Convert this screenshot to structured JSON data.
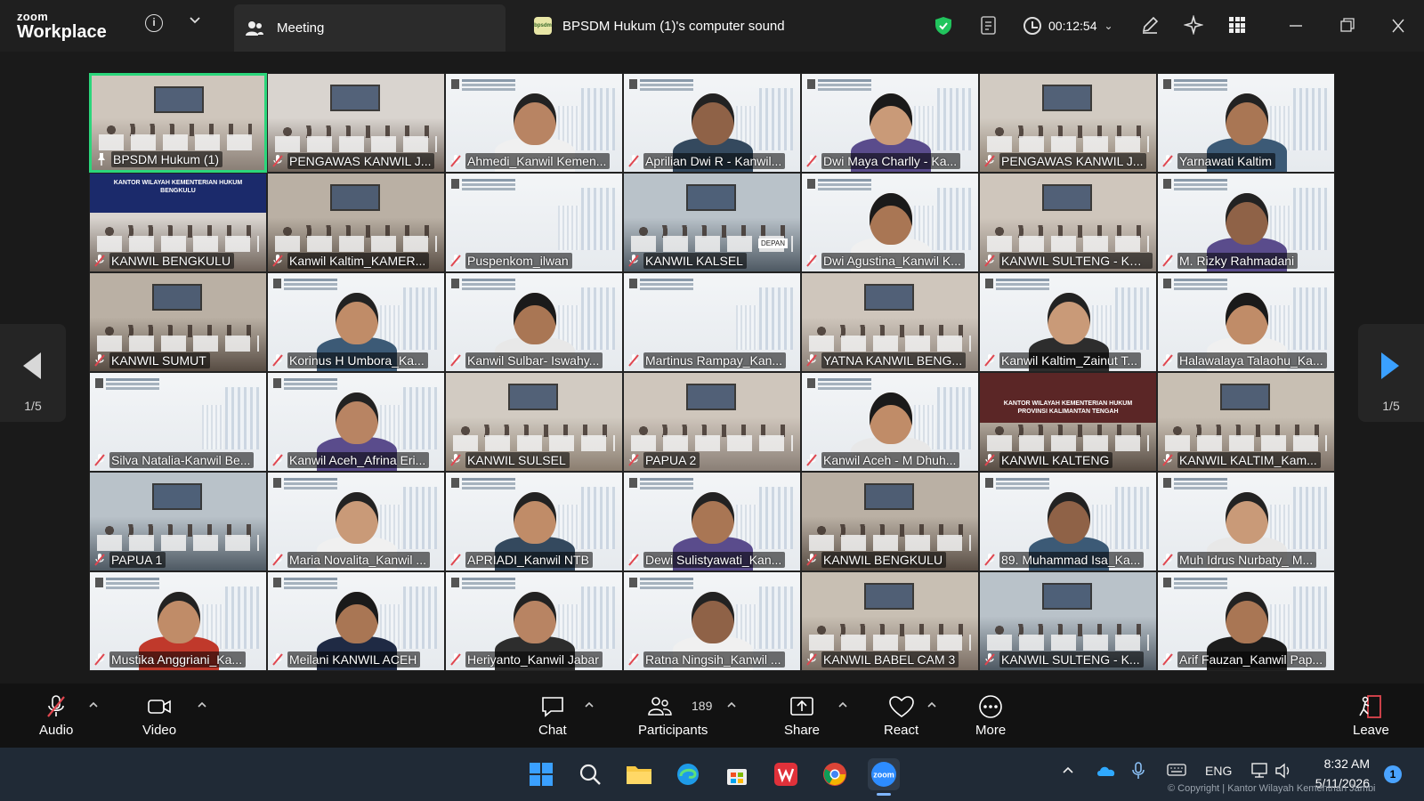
{
  "app": {
    "brand_top": "zoom",
    "brand_bottom": "Workplace"
  },
  "titlebar": {
    "meeting_tab": "Meeting",
    "sound_tab": "BPSDM Hukum (1)'s computer sound",
    "timer": "00:12:54"
  },
  "navigation": {
    "left_page": "1/5",
    "right_page": "1/5"
  },
  "participants_grid": [
    {
      "name": "BPSDM Hukum (1)",
      "type": "room",
      "active": true
    },
    {
      "name": "PENGAWAS KANWIL J...",
      "type": "room"
    },
    {
      "name": "Ahmedi_Kanwil Kemen...",
      "type": "person"
    },
    {
      "name": "Aprilian Dwi R - Kanwil...",
      "type": "person"
    },
    {
      "name": "Dwi Maya Charlly - Ka...",
      "type": "person"
    },
    {
      "name": "PENGAWAS KANWIL J...",
      "type": "room"
    },
    {
      "name": "Yarnawati Kaltim",
      "type": "person"
    },
    {
      "name": "KANWIL BENGKULU",
      "type": "room"
    },
    {
      "name": "Kanwil Kaltim_KAMER...",
      "type": "room"
    },
    {
      "name": "Puspenkom_ilwan",
      "type": "blank"
    },
    {
      "name": "KANWIL KALSEL",
      "type": "room"
    },
    {
      "name": "Dwi Agustina_Kanwil K...",
      "type": "person"
    },
    {
      "name": "KANWIL SULTENG - KAM...",
      "type": "room"
    },
    {
      "name": "M. Rizky Rahmadani",
      "type": "person"
    },
    {
      "name": "KANWIL SUMUT",
      "type": "room"
    },
    {
      "name": "Korinus H Umbora_Ka...",
      "type": "person"
    },
    {
      "name": "Kanwil Sulbar- Iswahy...",
      "type": "person"
    },
    {
      "name": "Martinus Rampay_Kan...",
      "type": "blank"
    },
    {
      "name": "YATNA KANWIL BENG...",
      "type": "room"
    },
    {
      "name": "Kanwil Kaltim_Zainut T...",
      "type": "person"
    },
    {
      "name": "Halawalaya Talaohu_Ka...",
      "type": "person"
    },
    {
      "name": "Silva Natalia-Kanwil Be...",
      "type": "blank"
    },
    {
      "name": "Kanwil  Aceh_Afrina Eri...",
      "type": "person"
    },
    {
      "name": "KANWIL SULSEL",
      "type": "room"
    },
    {
      "name": "PAPUA 2",
      "type": "room"
    },
    {
      "name": "Kanwil Aceh - M Dhuh...",
      "type": "person"
    },
    {
      "name": "KANWIL KALTENG",
      "type": "room"
    },
    {
      "name": "KANWIL KALTIM_Kam...",
      "type": "room"
    },
    {
      "name": "PAPUA 1",
      "type": "room"
    },
    {
      "name": "Maria Novalita_Kanwil ...",
      "type": "person"
    },
    {
      "name": "APRIADI_Kanwil NTB",
      "type": "person"
    },
    {
      "name": "Dewi Sulistyawati_Kan...",
      "type": "person"
    },
    {
      "name": "KANWIL BENGKULU",
      "type": "room"
    },
    {
      "name": "89. Muhammad Isa_Ka...",
      "type": "person"
    },
    {
      "name": "Muh Idrus Nurbaty_ M...",
      "type": "person"
    },
    {
      "name": "Mustika Anggriani_Ka...",
      "type": "person"
    },
    {
      "name": "Meilani KANWIL ACEH",
      "type": "person"
    },
    {
      "name": "Heriyanto_Kanwil Jabar",
      "type": "person"
    },
    {
      "name": "Ratna Ningsih_Kanwil ...",
      "type": "person"
    },
    {
      "name": "KANWIL BABEL CAM 3",
      "type": "room"
    },
    {
      "name": "KANWIL SULTENG - K...",
      "type": "room"
    },
    {
      "name": "Arif Fauzan_Kanwil Pap...",
      "type": "person"
    }
  ],
  "tile_overlays": {
    "bengkulu_banner_1": "KANTOR WILAYAH KEMENTERIAN HUKUM",
    "bengkulu_banner_2": "BENGKULU",
    "kalteng_banner_1": "KANTOR WILAYAH KEMENTERIAN HUKUM",
    "kalteng_banner_2": "PROVINSI KALIMANTAN TENGAH",
    "kalsel_sign": "DEPAN"
  },
  "toolbar": {
    "audio": "Audio",
    "video": "Video",
    "chat": "Chat",
    "participants": "Participants",
    "participants_count": "189",
    "share": "Share",
    "react": "React",
    "more": "More",
    "leave": "Leave"
  },
  "taskbar": {
    "language": "ENG",
    "time": "8:32 AM",
    "date": "5/11/2026",
    "notification_count": "1",
    "zoom_app_label": "zoom"
  },
  "watermark": "© Copyright | Kantor Wilayah Kementrian Jambi",
  "colors": {
    "active_speaker": "#2bd67b",
    "leave_red": "#e0464f",
    "shield_green": "#21c45d",
    "accent_blue": "#4aa3ff"
  }
}
